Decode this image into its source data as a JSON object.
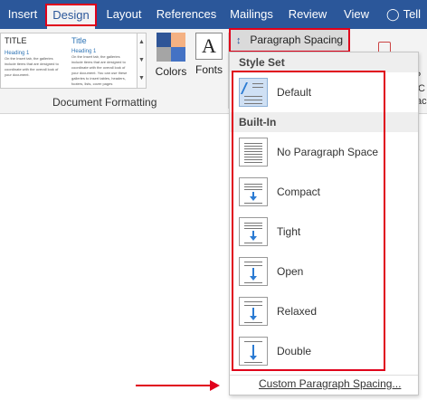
{
  "tabs": [
    {
      "label": "Insert"
    },
    {
      "label": "Design",
      "active": true
    },
    {
      "label": "Layout"
    },
    {
      "label": "References"
    },
    {
      "label": "Mailings"
    },
    {
      "label": "Review"
    },
    {
      "label": "View"
    }
  ],
  "tell_me": "Tell",
  "gallery": {
    "thumb1": {
      "title": "TITLE",
      "heading": "Heading 1",
      "body": "On the Insert tab, the galleries include items that are designed to coordinate with the overall look of your document."
    },
    "thumb2": {
      "title": "Title",
      "heading": "Heading 1",
      "body": "On the Insert tab, the galleries include items that are designed to coordinate with the overall look of your document. You can use these galleries to insert tables, headers, footers, lists, cover pages"
    }
  },
  "colors_label": "Colors",
  "fonts_label": "Fonts",
  "fonts_glyph": "A",
  "group_label": "Document Formatting",
  "paragraph_spacing": {
    "label": "Paragraph Spacing",
    "caret": "▾"
  },
  "right_fragment": {
    "p": "P",
    "c": "C",
    "ac": "ac"
  },
  "dropdown": {
    "style_set_header": "Style Set",
    "default_label": "Default",
    "built_in_header": "Built-In",
    "items": [
      {
        "label": "No Paragraph Space"
      },
      {
        "label": "Compact"
      },
      {
        "label": "Tight"
      },
      {
        "label": "Open"
      },
      {
        "label": "Relaxed"
      },
      {
        "label": "Double"
      }
    ],
    "custom_label": "Custom Paragraph Spacing..."
  },
  "colors": {
    "ribbon_blue": "#2b579a",
    "highlight_red": "#e0001b",
    "swatch": [
      "#2f5597",
      "#f4b183",
      "#a5a5a5",
      "#4472c4"
    ]
  }
}
